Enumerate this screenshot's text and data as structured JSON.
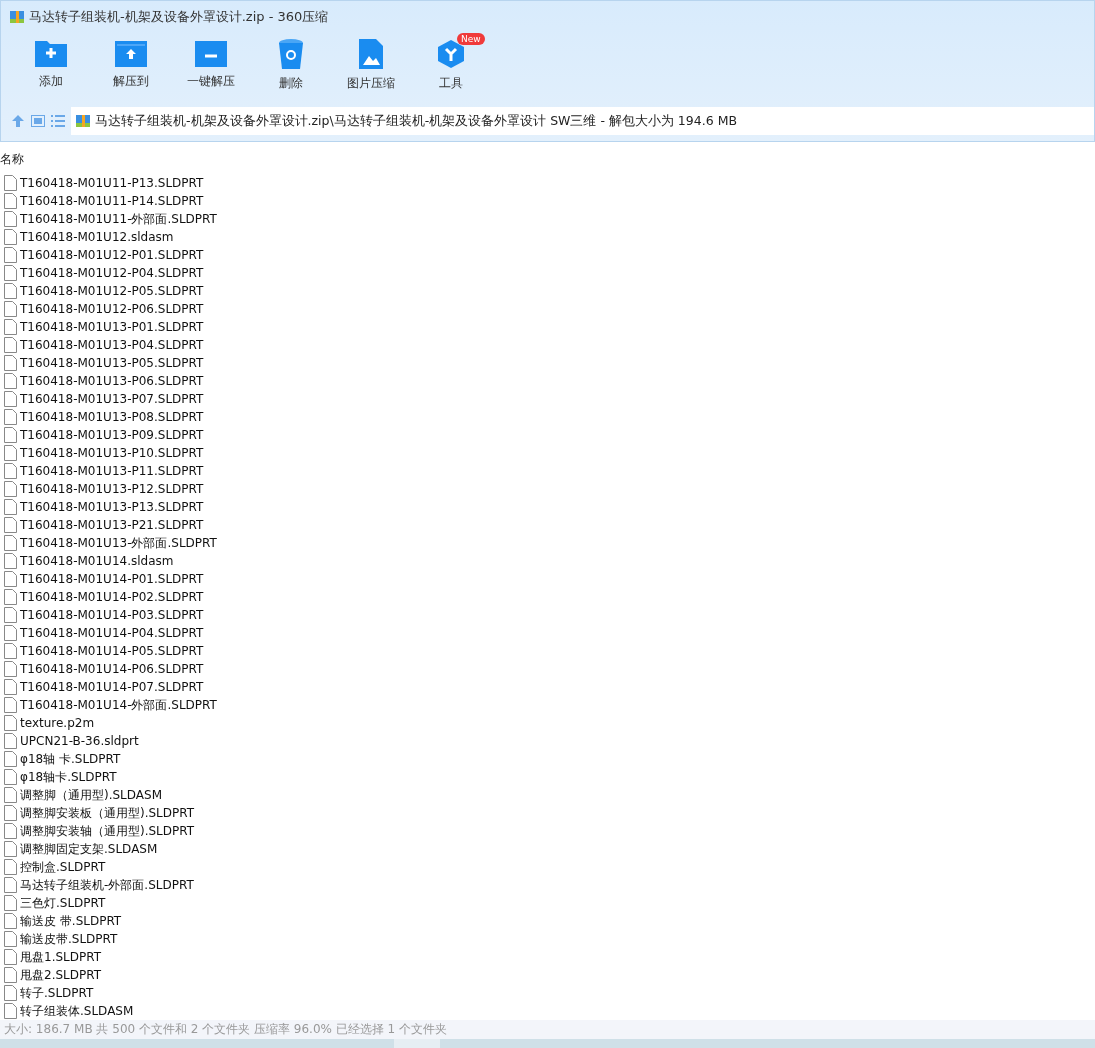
{
  "window": {
    "title": "马达转子组装机-机架及设备外罩设计.zip - 360压缩"
  },
  "toolbar": [
    {
      "kind": "add",
      "label": "添加"
    },
    {
      "kind": "extract",
      "label": "解压到"
    },
    {
      "kind": "quick",
      "label": "一键解压"
    },
    {
      "kind": "delete",
      "label": "删除"
    },
    {
      "kind": "image",
      "label": "图片压缩"
    },
    {
      "kind": "tools",
      "label": "工具",
      "badge": "New"
    }
  ],
  "address": {
    "path": "马达转子组装机-机架及设备外罩设计.zip\\马达转子组装机-机架及设备外罩设计 SW三维 - 解包大小为 194.6 MB"
  },
  "table": {
    "columns": [
      "名称"
    ],
    "rows": [
      "T160418-M01U11-P13.SLDPRT",
      "T160418-M01U11-P14.SLDPRT",
      "T160418-M01U11-外部面.SLDPRT",
      "T160418-M01U12.sldasm",
      "T160418-M01U12-P01.SLDPRT",
      "T160418-M01U12-P04.SLDPRT",
      "T160418-M01U12-P05.SLDPRT",
      "T160418-M01U12-P06.SLDPRT",
      "T160418-M01U13-P01.SLDPRT",
      "T160418-M01U13-P04.SLDPRT",
      "T160418-M01U13-P05.SLDPRT",
      "T160418-M01U13-P06.SLDPRT",
      "T160418-M01U13-P07.SLDPRT",
      "T160418-M01U13-P08.SLDPRT",
      "T160418-M01U13-P09.SLDPRT",
      "T160418-M01U13-P10.SLDPRT",
      "T160418-M01U13-P11.SLDPRT",
      "T160418-M01U13-P12.SLDPRT",
      "T160418-M01U13-P13.SLDPRT",
      "T160418-M01U13-P21.SLDPRT",
      "T160418-M01U13-外部面.SLDPRT",
      "T160418-M01U14.sldasm",
      "T160418-M01U14-P01.SLDPRT",
      "T160418-M01U14-P02.SLDPRT",
      "T160418-M01U14-P03.SLDPRT",
      "T160418-M01U14-P04.SLDPRT",
      "T160418-M01U14-P05.SLDPRT",
      "T160418-M01U14-P06.SLDPRT",
      "T160418-M01U14-P07.SLDPRT",
      "T160418-M01U14-外部面.SLDPRT",
      "texture.p2m",
      "UPCN21-B-36.sldprt",
      "φ18轴 卡.SLDPRT",
      "φ18轴卡.SLDPRT",
      "调整脚（通用型).SLDASM",
      "调整脚安装板（通用型).SLDPRT",
      "调整脚安装轴（通用型).SLDPRT",
      "调整脚固定支架.SLDASM",
      "控制盒.SLDPRT",
      "马达转子组装机-外部面.SLDPRT",
      "三色灯.SLDPRT",
      "输送皮 带.SLDPRT",
      "输送皮带.SLDPRT",
      "甩盘1.SLDPRT",
      "甩盘2.SLDPRT",
      "转子.SLDPRT",
      "转子组装体.SLDASM"
    ]
  },
  "status_bar": "大小: 186.7 MB 共 500 个文件和 2 个文件夹 压缩率 96.0% 已经选择 1 个文件夹"
}
